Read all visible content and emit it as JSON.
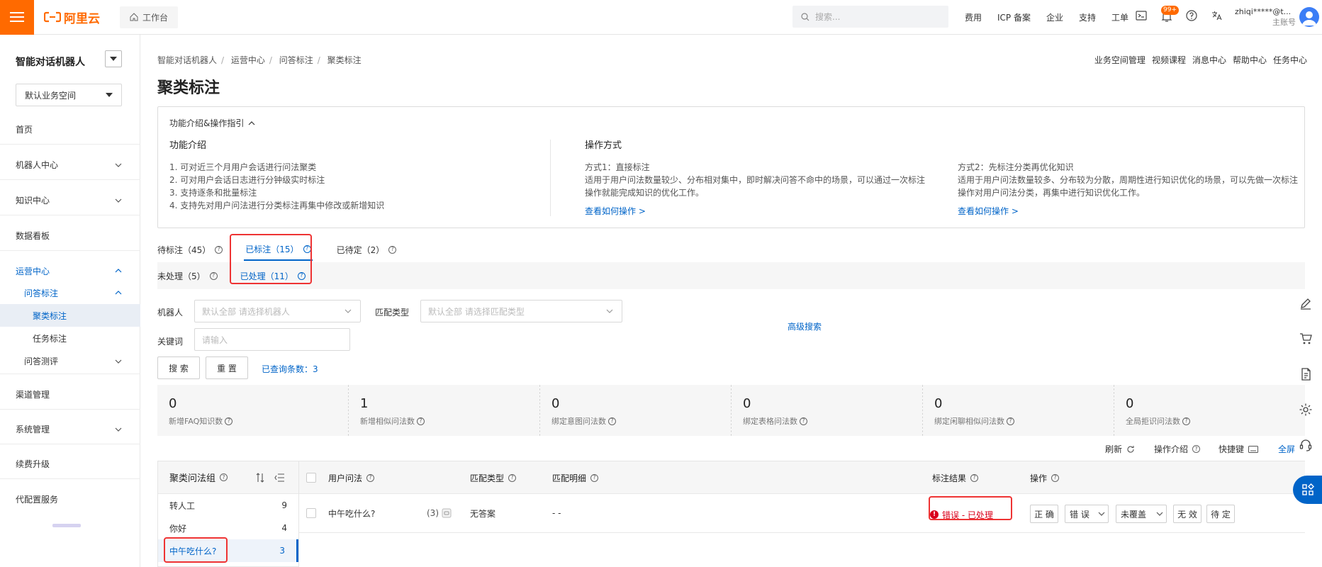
{
  "topbar": {
    "brand": "阿里云",
    "workbench": "工作台",
    "search_placeholder": "搜索...",
    "links": [
      "费用",
      "ICP 备案",
      "企业",
      "支持",
      "工单"
    ],
    "badge": "99+",
    "user_name": "zhiqi*****@t...",
    "user_role": "主账号",
    "accent": "#ff6a00"
  },
  "sidebar": {
    "title": "智能对话机器人",
    "workspace": "默认业务空间",
    "items": [
      {
        "label": "首页"
      },
      {
        "label": "机器人中心"
      },
      {
        "label": "知识中心"
      },
      {
        "label": "数据看板"
      },
      {
        "label": "运营中心"
      },
      {
        "label": "渠道管理"
      },
      {
        "label": "系统管理"
      },
      {
        "label": "续费升级"
      },
      {
        "label": "代配置服务"
      }
    ],
    "sub": {
      "qa_label": "问答标注",
      "cluster": "聚类标注",
      "task": "任务标注",
      "eval": "问答测评"
    }
  },
  "breadcrumb": {
    "items": [
      "智能对话机器人",
      "运营中心",
      "问答标注",
      "聚类标注"
    ]
  },
  "header_links": [
    "业务空间管理",
    "视频课程",
    "消息中心",
    "帮助中心",
    "任务中心"
  ],
  "page_title": "聚类标注",
  "intro": {
    "toggle_label": "功能介绍&操作指引",
    "feature_title": "功能介绍",
    "features": [
      "1. 可对近三个月用户会话进行问法聚类",
      "2. 可对用户会话日志进行分钟级实时标注",
      "3. 支持逐条和批量标注",
      "4. 支持先对用户问法进行分类标注再集中修改或新增知识"
    ],
    "ops_title": "操作方式",
    "mode1_title": "方式1：直接标注",
    "mode1_desc": "适用于用户问法数量较少、分布相对集中，即时解决问答不命中的场景，可以通过一次标注操作就能完成知识的优化工作。",
    "mode2_title": "方式2：先标注分类再优化知识",
    "mode2_desc": "适用于用户问法数量较多、分布较为分散，周期性进行知识优化的场景，可以先做一次标注操作对用户问法分类，再集中进行知识优化工作。",
    "link": "查看如何操作 >"
  },
  "tabs": {
    "main": [
      {
        "label": "待标注（45）"
      },
      {
        "label": "已标注（15）"
      },
      {
        "label": "已待定（2）"
      }
    ],
    "sub": [
      {
        "label": "未处理（5）"
      },
      {
        "label": "已处理（11）"
      }
    ]
  },
  "filters": {
    "robot_label": "机器人",
    "robot_placeholder": "默认全部 请选择机器人",
    "match_label": "匹配类型",
    "match_placeholder": "默认全部 请选择匹配类型",
    "keyword_label": "关键词",
    "keyword_placeholder": "请输入",
    "advanced": "高级搜索",
    "search_btn": "搜 索",
    "reset_btn": "重 置",
    "query_count": "已查询条数：3"
  },
  "stats": [
    {
      "value": "0",
      "label": "新增FAQ知识数"
    },
    {
      "value": "1",
      "label": "新增相似问法数"
    },
    {
      "value": "0",
      "label": "绑定意图问法数"
    },
    {
      "value": "0",
      "label": "绑定表格问法数"
    },
    {
      "value": "0",
      "label": "绑定闲聊相似问法数"
    },
    {
      "value": "0",
      "label": "全局拒识问法数"
    }
  ],
  "toolbar": {
    "refresh": "刷新",
    "intro": "操作介绍",
    "shortcut": "快捷键",
    "fullscreen": "全屏"
  },
  "groups": {
    "title": "聚类问法组",
    "items": [
      {
        "name": "转人工",
        "count": "9"
      },
      {
        "name": "你好",
        "count": "4"
      },
      {
        "name": "中午吃什么?",
        "count": "3"
      }
    ]
  },
  "table": {
    "headers": {
      "question": "用户问法",
      "match_type": "匹配类型",
      "match_detail": "匹配明细",
      "result": "标注结果",
      "action": "操作"
    },
    "rows": [
      {
        "question": "中午吃什么?",
        "count": "(3)",
        "match_type": "无答案",
        "match_detail": "- -",
        "result": "错误 - 已处理",
        "actions": {
          "correct": "正 确",
          "wrong": "错 误",
          "uncovered": "未覆盖",
          "invalid": "无 效",
          "pending": "待 定"
        }
      }
    ]
  }
}
